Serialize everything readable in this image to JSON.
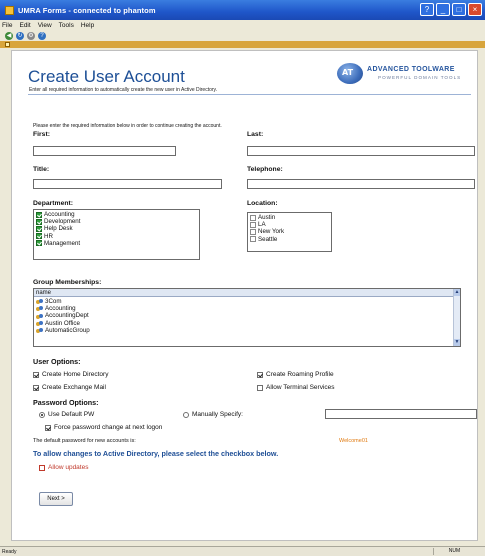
{
  "window": {
    "title": "UMRA Forms - connected to phantom",
    "buttons": [
      "help",
      "minimize",
      "maximize",
      "close"
    ]
  },
  "menubar": [
    "File",
    "Edit",
    "View",
    "Tools",
    "Help"
  ],
  "toolbar": [
    "back-icon",
    "refresh-icon",
    "settings-icon",
    "help-icon"
  ],
  "header": {
    "title": "Create User Account",
    "subtitle": "Enter all required information to automatically create the new user in Active Directory.",
    "logo_mark": "AT",
    "logo_name": "ADVANCED TOOLWARE",
    "logo_tagline": "POWERFUL DOMAIN TOOLS"
  },
  "instructions": "Please enter the required information below in order to continue creating the account.",
  "fields": {
    "first": {
      "label": "First:",
      "value": ""
    },
    "last": {
      "label": "Last:",
      "value": ""
    },
    "title": {
      "label": "Title:",
      "value": ""
    },
    "telephone": {
      "label": "Telephone:",
      "value": ""
    }
  },
  "department": {
    "label": "Department:",
    "items": [
      "Accounting",
      "Development",
      "Help Desk",
      "HR",
      "Management"
    ]
  },
  "location": {
    "label": "Location:",
    "items": [
      "Austin",
      "LA",
      "New York",
      "Seattle"
    ]
  },
  "groups": {
    "label": "Group Memberships:",
    "column": "name",
    "items": [
      "3Com",
      "Accounting",
      "AccountingDept",
      "Austin Office",
      "AutomaticGroup"
    ]
  },
  "user_options": {
    "label": "User Options:",
    "create_home_directory": {
      "label": "Create Home Directory",
      "checked": true
    },
    "create_exchange_mail": {
      "label": "Create Exchange Mail",
      "checked": true
    },
    "create_roaming_profile": {
      "label": "Create Roaming Profile",
      "checked": true
    },
    "allow_terminal_services": {
      "label": "Allow Terminal Services",
      "checked": false
    }
  },
  "password_options": {
    "label": "Password Options:",
    "use_default": {
      "label": "Use Default PW",
      "selected": true
    },
    "manually_specify": {
      "label": "Manually Specify:",
      "selected": false
    },
    "manual_value": "",
    "force_change": {
      "label": "Force password change at next logon",
      "checked": true
    },
    "default_note": "The default password for new accounts is:",
    "default_value": "Welcome01"
  },
  "ad_changes": {
    "heading": "To allow changes to Active Directory, please select the checkbox below.",
    "allow_updates": {
      "label": "Allow updates",
      "checked": false
    }
  },
  "next_button": "Next >",
  "status": {
    "text": "Ready",
    "zone": "NUM"
  },
  "colors": {
    "title_bar": "#1f56c9",
    "heading": "#1d4f96",
    "accent_red": "#c0392b",
    "accent_orange": "#e07a10",
    "dept_check": "#2e9e3c"
  }
}
